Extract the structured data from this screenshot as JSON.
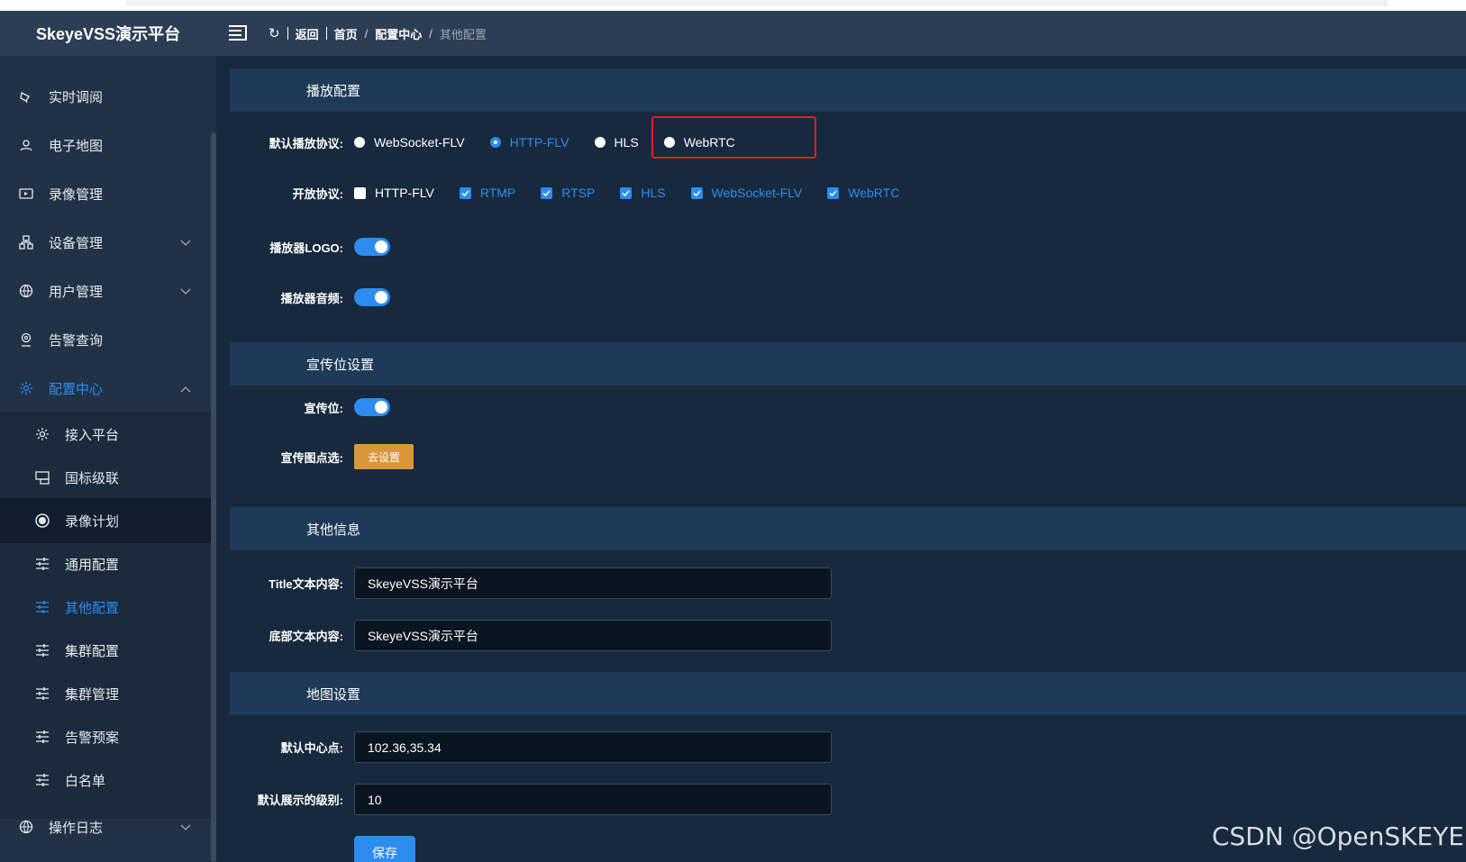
{
  "app": {
    "title": "SkeyeVSS演示平台"
  },
  "breadcrumb": {
    "back": "返回",
    "home": "首页",
    "parent": "配置中心",
    "current": "其他配置"
  },
  "sidebar": {
    "items": [
      {
        "label": "实时调阅",
        "icon": "camera-icon"
      },
      {
        "label": "电子地图",
        "icon": "map-pin-icon"
      },
      {
        "label": "录像管理",
        "icon": "video-icon"
      },
      {
        "label": "设备管理",
        "icon": "device-tree-icon"
      },
      {
        "label": "用户管理",
        "icon": "globe-icon"
      },
      {
        "label": "告警查询",
        "icon": "alarm-icon"
      },
      {
        "label": "配置中心",
        "icon": "gear-icon"
      }
    ],
    "sub_items": [
      {
        "label": "接入平台"
      },
      {
        "label": "国标级联"
      },
      {
        "label": "录像计划"
      },
      {
        "label": "通用配置"
      },
      {
        "label": "其他配置"
      },
      {
        "label": "集群配置"
      },
      {
        "label": "集群管理"
      },
      {
        "label": "告警预案"
      },
      {
        "label": "白名单"
      }
    ],
    "bottom_item": {
      "label": "操作日志"
    }
  },
  "sections": {
    "playback": "播放配置",
    "promo": "宣传位设置",
    "other": "其他信息",
    "map": "地图设置"
  },
  "playback": {
    "protocol_label": "默认播放协议:",
    "protocols": [
      "WebSocket-FLV",
      "HTTP-FLV",
      "HLS",
      "WebRTC"
    ],
    "selected_protocol": "HTTP-FLV",
    "open_label": "开放协议:",
    "open_protocols": [
      {
        "name": "HTTP-FLV",
        "checked": false
      },
      {
        "name": "RTMP",
        "checked": true
      },
      {
        "name": "RTSP",
        "checked": true
      },
      {
        "name": "HLS",
        "checked": true
      },
      {
        "name": "WebSocket-FLV",
        "checked": true
      },
      {
        "name": "WebRTC",
        "checked": true
      }
    ],
    "logo_label": "播放器LOGO:",
    "logo_on": true,
    "audio_label": "播放器音频:",
    "audio_on": true
  },
  "promo": {
    "enable_label": "宣传位:",
    "enable_on": true,
    "image_label": "宣传图点选:",
    "image_button": "去设置"
  },
  "other": {
    "title_label": "Title文本内容:",
    "title_value": "SkeyeVSS演示平台",
    "footer_label": "底部文本内容:",
    "footer_value": "SkeyeVSS演示平台"
  },
  "map": {
    "center_label": "默认中心点:",
    "center_value": "102.36,35.34",
    "zoom_label": "默认展示的级别:",
    "zoom_value": "10",
    "save_button": "保存"
  },
  "watermark": "CSDN @OpenSKEYE",
  "colors": {
    "accent": "#2d8cf0",
    "warning": "#d9973a",
    "highlight": "#e02020"
  }
}
